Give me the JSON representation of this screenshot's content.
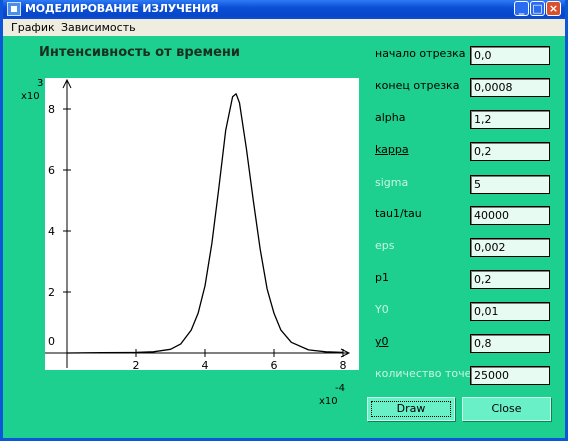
{
  "window": {
    "title": "МОДЕЛИРОВАНИЕ ИЗЛУЧЕНИЯ",
    "buttons": {
      "minimize": "_",
      "maximize": "□",
      "close": "×"
    }
  },
  "menu": {
    "items": [
      "График",
      "Зависимость"
    ]
  },
  "plot": {
    "title": "Интенсивность от времени"
  },
  "chart_data": {
    "type": "line",
    "title": "Интенсивность от времени",
    "xlabel": "",
    "ylabel": "",
    "x_exponent": "x10 -4",
    "y_exponent": "x10 3",
    "x_ticks": [
      2,
      4,
      6,
      8
    ],
    "y_ticks": [
      2,
      4,
      6,
      8
    ],
    "origin_label": "0",
    "xlim": [
      0,
      8.5
    ],
    "ylim": [
      0,
      8.8
    ],
    "series": [
      {
        "x": [
          0,
          1,
          2,
          2.5,
          3,
          3.3,
          3.6,
          3.8,
          4,
          4.2,
          4.4,
          4.6,
          4.8,
          4.9,
          5,
          5.2,
          5.4,
          5.6,
          5.8,
          6,
          6.2,
          6.5,
          7,
          7.5,
          8
        ],
        "values": [
          0,
          0.01,
          0.02,
          0.04,
          0.12,
          0.3,
          0.75,
          1.3,
          2.2,
          3.6,
          5.4,
          7.3,
          8.4,
          8.5,
          8.2,
          6.7,
          5.0,
          3.4,
          2.1,
          1.3,
          0.75,
          0.35,
          0.1,
          0.04,
          0.02
        ]
      }
    ]
  },
  "params": [
    {
      "label": "начало отрезка",
      "value": "0,0",
      "style": "normal"
    },
    {
      "label": "конец отрезка",
      "value": "0,0008",
      "style": "normal"
    },
    {
      "label": "alpha",
      "value": "1,2",
      "style": "normal"
    },
    {
      "label": "kappa",
      "value": "0,2",
      "style": "underline"
    },
    {
      "label": "sigma",
      "value": "5",
      "style": "dim"
    },
    {
      "label": "tau1/tau",
      "value": "40000",
      "style": "normal"
    },
    {
      "label": "eps",
      "value": "0,002",
      "style": "dim"
    },
    {
      "label": "p1",
      "value": "0,2",
      "style": "normal"
    },
    {
      "label": "Y0",
      "value": "0,01",
      "style": "dim"
    },
    {
      "label": "y0",
      "value": "0,8",
      "style": "underline"
    },
    {
      "label": "количество точек",
      "value": "25000",
      "style": "dim"
    }
  ],
  "buttons": {
    "draw": "Draw",
    "close": "Close"
  }
}
